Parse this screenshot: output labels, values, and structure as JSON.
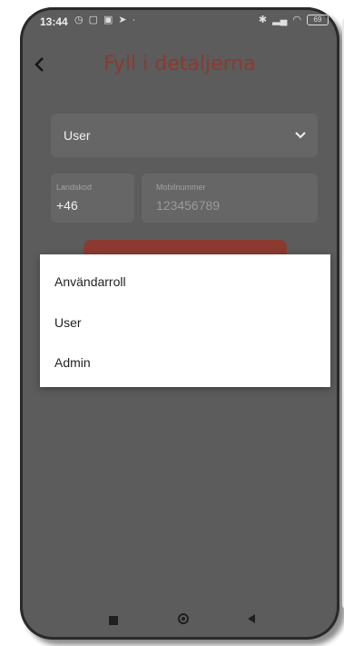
{
  "status_bar": {
    "time": "13:44",
    "battery": "69"
  },
  "header": {
    "title": "Fyll i detaljerna"
  },
  "form": {
    "role_value": "User",
    "country_code_label": "Landskod",
    "country_code_value": "+46",
    "mobile_label": "Mobilnummer",
    "mobile_placeholder": "123456789"
  },
  "menu": {
    "items": [
      "Användarroll",
      "User",
      "Admin"
    ]
  },
  "colors": {
    "accent": "#8b3a2f",
    "overlay_background": "#5c5c5c",
    "menu_background": "#ffffff"
  }
}
